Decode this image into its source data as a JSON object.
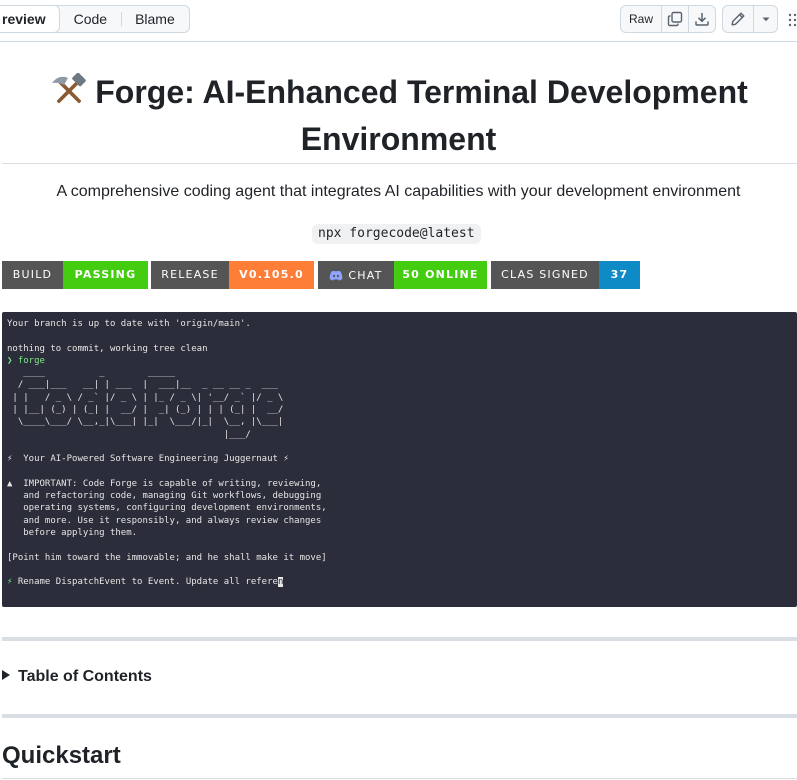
{
  "toolbar": {
    "tabs": [
      {
        "label": "review",
        "active": true
      },
      {
        "label": "Code",
        "active": false
      },
      {
        "label": "Blame",
        "active": false
      }
    ],
    "raw_label": "Raw",
    "copy_icon": "copy-icon",
    "download_icon": "download-icon",
    "edit_icon": "pencil-icon",
    "more_icon": "triangle-down-icon"
  },
  "readme": {
    "title_emoji": "hammer-and-pick",
    "title": "Forge: AI-Enhanced Terminal Development Environment",
    "subtitle": "A comprehensive coding agent that integrates AI capabilities with your development environment",
    "install_command": "npx forgecode@latest",
    "badges": [
      {
        "label": "BUILD",
        "value": "PASSING",
        "color": "#4c1"
      },
      {
        "label": "RELEASE",
        "value": "V0.105.0",
        "color": "#fe7d37"
      },
      {
        "label": "CHAT",
        "value": "50 ONLINE",
        "color": "#4c1",
        "icon": "discord-icon"
      },
      {
        "label": "CLAS SIGNED",
        "value": "37",
        "color": "#0e8bc7"
      }
    ],
    "terminal": {
      "line1": "Your branch is up to date with 'origin/main'.",
      "line2": "nothing to commit, working tree clean",
      "prompt": "❯ forge",
      "tagline": "⚡  Your AI-Powered Software Engineering Juggernaut ⚡",
      "important": "▲  IMPORTANT: Code Forge is capable of writing, reviewing,\n   and refactoring code, managing Git workflows, debugging\n   operating systems, configuring development environments,\n   and more. Use it responsibly, and always review changes\n   before applying them.",
      "quote": "[Point him toward the immovable; and he shall make it move]",
      "input_prefix": "⚡",
      "input_text": " Rename DispatchEvent to Event. Update all refere",
      "cursor_char": "n"
    },
    "toc_label": "Table of Contents",
    "quickstart_heading": "Quickstart"
  }
}
